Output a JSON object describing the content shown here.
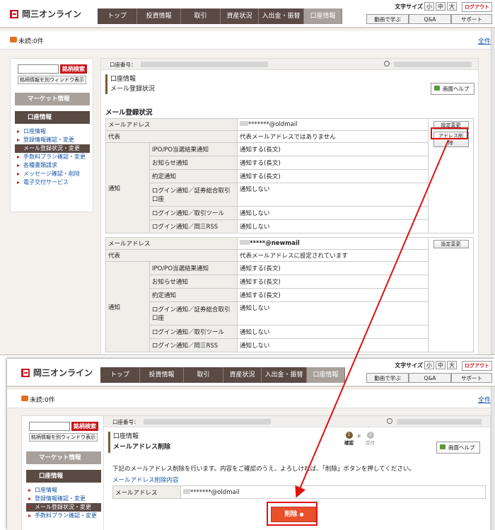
{
  "brand": "岡三オンライン",
  "nav": [
    "トップ",
    "投資情報",
    "取引",
    "資産状況",
    "入出金・振替",
    "口座情報"
  ],
  "font_size": {
    "label": "文字サイズ",
    "options": [
      "小",
      "中",
      "大"
    ]
  },
  "logout": "ログアウト",
  "sub_nav": [
    "動画で学ぶ",
    "Q&A",
    "サポート"
  ],
  "unread": "未読:0件",
  "all_link": "全件",
  "sidebar": {
    "search_button": "銘柄検索",
    "popup_link": "銘柄情報を別ウィンドウ表示",
    "market": "マーケット情報",
    "account": "口座情報",
    "items": [
      "口座情報",
      "登録情報確認・変更",
      "メール登録状況・変更",
      "手数料プラン確認・変更",
      "各種書類請求",
      "メッセージ確認・削除",
      "電子交付サービス"
    ]
  },
  "account_label": "口座番号：",
  "screen1": {
    "breadcrumb": "口座情報",
    "title": "メール登録状況",
    "help": "画面ヘルプ",
    "section": "メール登録状況",
    "blocks": [
      {
        "email_label": "メールアドレス",
        "email": "*******@oldmail",
        "rep_label": "代表",
        "rep_value": "代表メールアドレスではありません",
        "notify_label": "通知",
        "rows": [
          {
            "k": "IPO/PO当選結果通知",
            "v": "通知する(長文)"
          },
          {
            "k": "お知らせ通知",
            "v": "通知する(長文)"
          },
          {
            "k": "約定通知",
            "v": "通知する(長文)"
          },
          {
            "k": "ログイン通知／証券総合取引口座",
            "v": "通知しない"
          },
          {
            "k": "ログイン通知／取引ツール",
            "v": "通知しない"
          },
          {
            "k": "ログイン通知／岡三RSS",
            "v": "通知しない"
          }
        ],
        "change": "設定変更",
        "delete": "アドレス削除"
      },
      {
        "email_label": "メールアドレス",
        "email": "*****@newmail",
        "rep_label": "代表",
        "rep_value": "代表メールアドレスに設定されています",
        "notify_label": "通知",
        "rows": [
          {
            "k": "IPO/PO当選結果通知",
            "v": "通知する(長文)"
          },
          {
            "k": "お知らせ通知",
            "v": "通知する(長文)"
          },
          {
            "k": "約定通知",
            "v": "通知する(長文)"
          },
          {
            "k": "ログイン通知／証券総合取引口座",
            "v": "通知しない"
          },
          {
            "k": "ログイン通知／取引ツール",
            "v": "通知しない"
          },
          {
            "k": "ログイン通知／岡三RSS",
            "v": "通知しない"
          }
        ],
        "change": "設定変更"
      }
    ]
  },
  "screen2": {
    "breadcrumb": "口座情報",
    "title": "メールアドレス削除",
    "steps": [
      {
        "n": "1",
        "label": "確認"
      },
      {
        "n": "2",
        "label": "受付"
      }
    ],
    "help": "画面ヘルプ",
    "description": "下記のメールアドレス削除を行います。内容をご確認のうえ、よろしければ、「削除」ボタンを押してください。",
    "subtitle": "メールアドレス削除内容",
    "email_label": "メールアドレス",
    "email": "*******@oldmail",
    "delete_button": "削除"
  },
  "colors": {
    "accent": "#c8161d",
    "nav": "#5a4a44",
    "highlight": "#e01010",
    "button": "#e8502a"
  }
}
